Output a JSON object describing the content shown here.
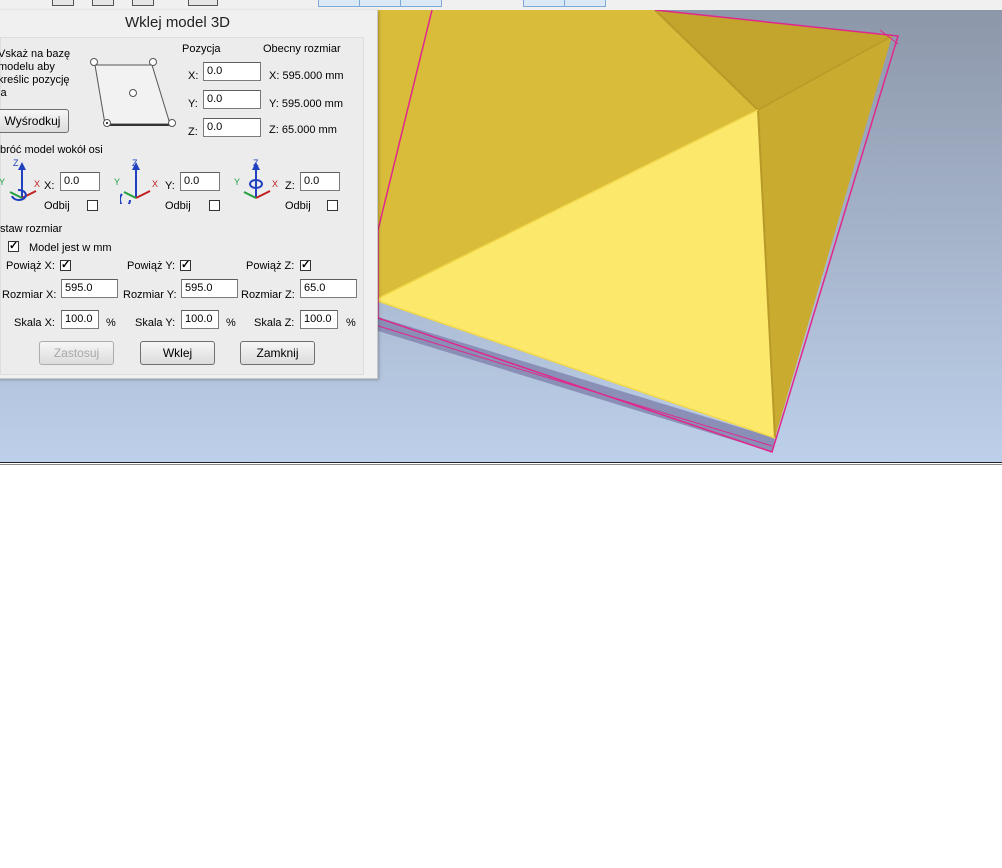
{
  "dialog": {
    "title": "Wklej model 3D",
    "instruction_lines": [
      "Vskaż na bazę",
      "modelu aby",
      "kreślic pozycję",
      "la"
    ],
    "center_button": "Wyśrodkuj",
    "position_header": "Pozycja",
    "current_size_header": "Obecny rozmiar",
    "position": {
      "x_label": "X:",
      "x_value": "0.0",
      "y_label": "Y:",
      "y_value": "0.0",
      "z_label": "Z:",
      "z_value": "0.0"
    },
    "current_size": {
      "x": "X:  595.000 mm",
      "y": "Y:  595.000 mm",
      "z": "Z:  65.000 mm"
    },
    "rotate_header": "bróć model wokół osi",
    "rotate": {
      "x_label": "X:",
      "x_value": "0.0",
      "y_label": "Y:",
      "y_value": "0.0",
      "z_label": "Z:",
      "z_value": "0.0",
      "mirror_label": "Odbij"
    },
    "axis_letters": {
      "x": "X",
      "y": "Y",
      "z": "Z"
    },
    "resize_header": "staw rozmiar",
    "model_in_mm": "Model jest w mm",
    "link": {
      "x": "Powiąż X:",
      "y": "Powiąż Y:",
      "z": "Powiąż Z:"
    },
    "size": {
      "x_label": "Rozmiar X:",
      "x_value": "595.0",
      "y_label": "Rozmiar Y:",
      "y_value": "595.0",
      "z_label": "Rozmiar Z:",
      "z_value": "65.0"
    },
    "scale": {
      "x_label": "Skala X:",
      "x_value": "100.0",
      "y_label": "Skala Y:",
      "y_value": "100.0",
      "z_label": "Skala Z:",
      "z_value": "100.0",
      "unit": "%"
    },
    "checkmark": "✓",
    "buttons": {
      "apply": "Zastosuj",
      "paste": "Wklej",
      "close": "Zamknij"
    }
  },
  "colors": {
    "model_light_face": "#fce86a",
    "model_mid_face": "#d9bc3a",
    "model_dark_face": "#c3a42c",
    "bounding_box": "#e0288c",
    "base_slab": "#8a8fb8"
  }
}
